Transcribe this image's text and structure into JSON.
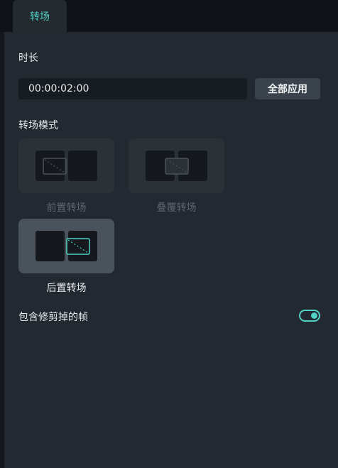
{
  "tabs": [
    {
      "label": "转场",
      "active": true
    }
  ],
  "duration": {
    "label": "时长",
    "value": "00:00:02:00",
    "apply_button": "全部应用"
  },
  "transition_mode": {
    "label": "转场模式",
    "options": [
      {
        "label": "前置转场",
        "selected": false
      },
      {
        "label": "叠覆转场",
        "selected": false
      },
      {
        "label": "后置转场",
        "selected": true
      }
    ]
  },
  "include_trimmed": {
    "label": "包含修剪掉的帧",
    "enabled": true
  },
  "colors": {
    "accent": "#4fd1c5",
    "panel_bg": "#222930",
    "selected_card": "#4a535b"
  }
}
